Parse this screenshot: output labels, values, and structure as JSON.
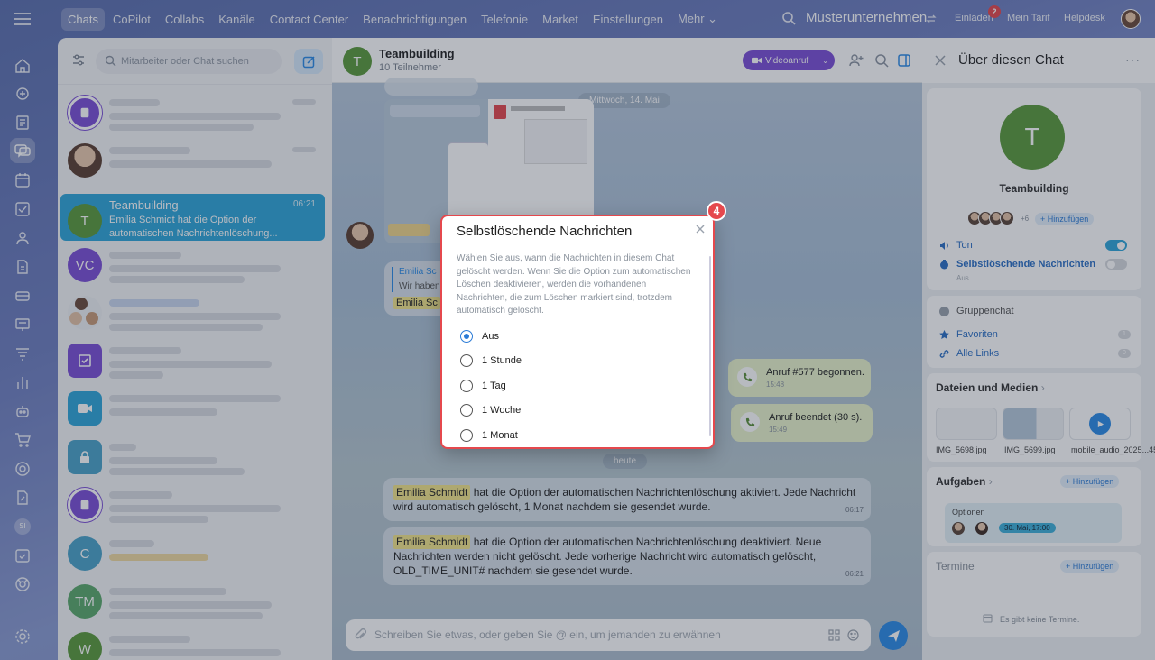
{
  "topnav": {
    "items": [
      "Chats",
      "CoPilot",
      "Collabs",
      "Kanäle",
      "Contact Center",
      "Benachrichtigungen",
      "Telefonie",
      "Market",
      "Einstellungen",
      "Mehr ⌄"
    ],
    "active_index": 0,
    "company": "Musterunternehmen",
    "invite": "Einladen",
    "invite_badge": "2",
    "plan": "Mein Tarif",
    "helpdesk": "Helpdesk"
  },
  "rail": {
    "icons": [
      "home-icon",
      "copilot-icon",
      "feed-icon",
      "chat-icon",
      "calendar-icon",
      "tasks-icon",
      "contacts-icon",
      "documents-icon",
      "crm-icon",
      "board-icon",
      "filter-icon",
      "analytics-icon",
      "bot-icon",
      "shop-icon",
      "target-icon",
      "sign-icon",
      "booking-icon",
      "support-icon",
      "settings-icon"
    ],
    "initials": "SI"
  },
  "chat_list": {
    "search_placeholder": "Mitarbeiter oder Chat suchen",
    "active_chat": {
      "initial": "T",
      "name": "Teambuilding",
      "time": "06:21",
      "preview": "Emilia Schmidt hat die Option der automatischen Nachrichtenlöschung..."
    },
    "other_initials": [
      "VC",
      "C",
      "TM",
      "W"
    ]
  },
  "chat_header": {
    "initial": "T",
    "title": "Teambuilding",
    "subtitle": "10 Teilnehmer",
    "video_label": "Videoanruf"
  },
  "messages": {
    "date_may": "Mittwoch, 14. Mai",
    "date_today": "heute",
    "call_started": "Anruf #577 begonnen.",
    "call_started_time": "15:48",
    "call_ended": "Anruf beendet (30 s).",
    "call_ended_time": "15:49",
    "msg1_name": "Emilia Schmidt",
    "msg1_text": " hat die Option der automatischen Nachrichtenlöschung aktiviert. Jede Nachricht wird automatisch gelöscht, 1 Monat nachdem sie gesendet wurde.",
    "msg1_time": "06:17",
    "msg2_name": "Emilia Schmidt",
    "msg2_text": " hat die Option der automatischen Nachrichtenlöschung deaktiviert. Neue Nachrichten werden nicht gelöscht. Jede vorherige Nachricht wird automatisch gelöscht, OLD_TIME_UNIT# nachdem sie gesendet wurde.",
    "msg2_time": "06:21",
    "quote_name": "Emilia Sc",
    "quote_text": "Wir haben",
    "quote_hl": "Emilia Sc"
  },
  "input": {
    "placeholder": "Schreiben Sie etwas, oder geben Sie @ ein, um jemanden zu erwähnen"
  },
  "modal": {
    "title": "Selbstlöschende Nachrichten",
    "description": "Wählen Sie aus, wann die Nachrichten in diesem Chat gelöscht werden. Wenn Sie die Option zum automatischen Löschen deaktivieren, werden die vorhandenen Nachrichten, die zum Löschen markiert sind, trotzdem automatisch gelöscht.",
    "options": [
      "Aus",
      "1 Stunde",
      "1 Tag",
      "1 Woche",
      "1 Monat"
    ],
    "selected_index": 0,
    "step_badge": "4"
  },
  "info_panel": {
    "title": "Über diesen Chat",
    "initial": "T",
    "group_name": "Teambuilding",
    "more_members": "+6",
    "add_label": "+ Hinzufügen",
    "sound_label": "Ton",
    "sound_on": true,
    "self_delete_label": "Selbstlöschende Nachrichten",
    "self_delete_on": false,
    "self_delete_sub": "Aus",
    "group_chat_label": "Gruppenchat",
    "favorites_label": "Favoriten",
    "favorites_count": "1",
    "links_label": "Alle Links",
    "links_count": "0",
    "files_title": "Dateien und Medien",
    "files": [
      "IMG_5698.jpg",
      "IMG_5699.jpg",
      "mobile_audio_2025...45.mp3"
    ],
    "tasks_title": "Aufgaben",
    "task_name": "Optionen",
    "task_date": "30. Mai, 17:00",
    "events_title": "Termine",
    "no_events": "Es gibt keine Termine."
  },
  "colors": {
    "accent": "#2b8be6",
    "active_chat": "#2fa6d9",
    "video": "#7b4fd6",
    "highlight": "#f2e58a",
    "badge": "#e5484d",
    "group_avatar": "#5a9a3b"
  }
}
